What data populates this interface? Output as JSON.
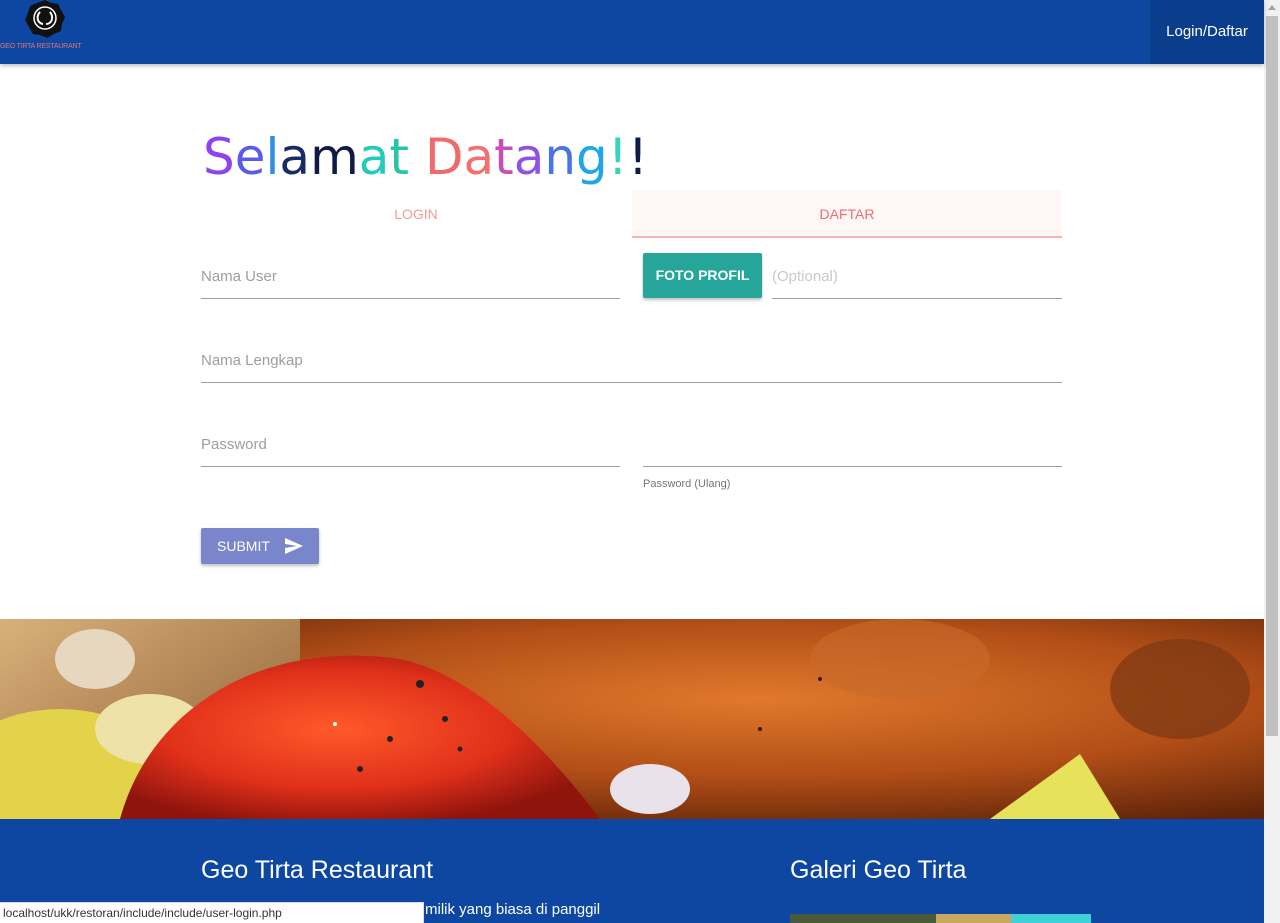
{
  "navbar": {
    "brand_name": "GEO TIRTA RESTAURANT",
    "brand_color": "#0d47a1",
    "login_link": "Login/Daftar"
  },
  "greeting": {
    "text": "Selamat Datang!!",
    "letters": [
      {
        "ch": "S",
        "color": "#8e44ec"
      },
      {
        "ch": "e",
        "color": "#5b5be8"
      },
      {
        "ch": "l",
        "color": "#2f8fe6"
      },
      {
        "ch": "a",
        "color": "#1a2a66"
      },
      {
        "ch": "m",
        "color": "#111a44"
      },
      {
        "ch": "a",
        "color": "#22ccb8"
      },
      {
        "ch": "t",
        "color": "#28c4a8"
      },
      {
        "ch": " ",
        "color": "#000000"
      },
      {
        "ch": "D",
        "color": "#f06a6a"
      },
      {
        "ch": "a",
        "color": "#f47070"
      },
      {
        "ch": "t",
        "color": "#c64fb8"
      },
      {
        "ch": "a",
        "color": "#8f52e4"
      },
      {
        "ch": "n",
        "color": "#4a74e6"
      },
      {
        "ch": "g",
        "color": "#1ea6e6"
      },
      {
        "ch": "!",
        "color": "#3ad2b8"
      },
      {
        "ch": "!",
        "color": "#111a44"
      }
    ]
  },
  "tabs": {
    "login": "LOGIN",
    "daftar": "DAFTAR",
    "active": "daftar"
  },
  "form": {
    "nama_user_placeholder": "Nama User",
    "foto_profil_button": "FOTO PROFIL",
    "foto_optional_placeholder": "(Optional)",
    "nama_lengkap_placeholder": "Nama Lengkap",
    "password_placeholder": "Password",
    "password_ulang_value": "",
    "password_ulang_label": "Password (Ulang)",
    "submit_label": "SUBMIT"
  },
  "footer": {
    "title": "Geo Tirta Restaurant",
    "description_fragment": "milik yang biasa di panggil",
    "gallery_title": "Galeri Geo Tirta"
  },
  "status_bar": {
    "url": "localhost/ukk/restoran/include/include/user-login.php"
  }
}
